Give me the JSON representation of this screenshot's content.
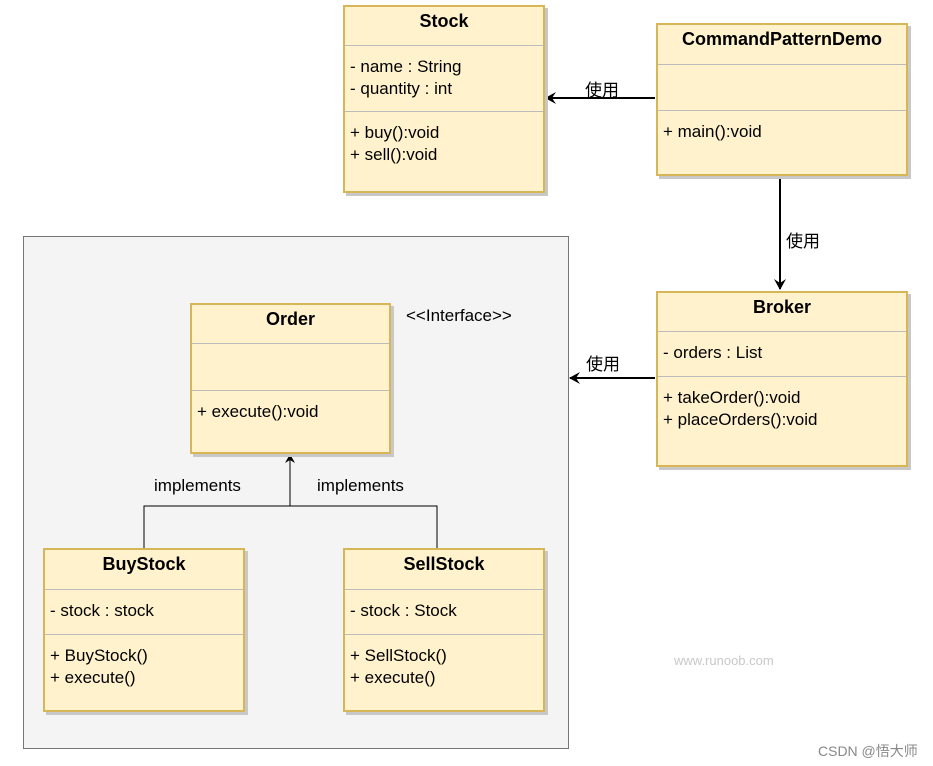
{
  "classes": {
    "stock": {
      "name": "Stock",
      "attributes": [
        "- name : String",
        "- quantity : int"
      ],
      "methods": [
        "+ buy():void",
        "+ sell():void"
      ]
    },
    "demo": {
      "name": "CommandPatternDemo",
      "attributes": [],
      "methods": [
        "+ main():void"
      ]
    },
    "broker": {
      "name": "Broker",
      "attributes": [
        "- orders : List"
      ],
      "methods": [
        "+ takeOrder():void",
        "+ placeOrders():void"
      ]
    },
    "order": {
      "name": "Order",
      "attributes": [],
      "methods": [
        "+ execute():void"
      ]
    },
    "buystock": {
      "name": "BuyStock",
      "attributes": [
        "- stock : stock"
      ],
      "methods": [
        "+ BuyStock()",
        "+ execute()"
      ]
    },
    "sellstock": {
      "name": "SellStock",
      "attributes": [
        "- stock : Stock"
      ],
      "methods": [
        "+ SellStock()",
        "+ execute()"
      ]
    }
  },
  "labels": {
    "uses_demo_stock": "使用",
    "uses_demo_broker": "使用",
    "uses_broker_orders": "使用",
    "interface_stereotype": "<<Interface>>",
    "implements_buy": "implements",
    "implements_sell": "implements"
  },
  "watermarks": {
    "site": "www.runoob.com",
    "author": "CSDN @悟大师"
  },
  "colors": {
    "class_fill": "#fff2cc",
    "class_border": "#d6b656",
    "container_fill": "#f4f4f4"
  }
}
